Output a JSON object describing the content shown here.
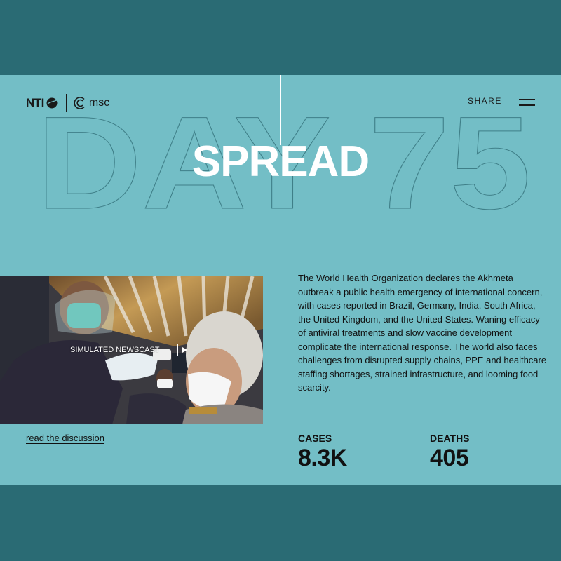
{
  "header": {
    "logo_nti": "NTI",
    "logo_msc": "msc",
    "share_label": "SHARE",
    "menu_icon": "hamburger-menu-icon"
  },
  "hero": {
    "background_text": "DAY 75",
    "title": "SPREAD"
  },
  "video": {
    "label": "SIMULATED NEWSCAST",
    "play_icon": "play-icon",
    "link_label": "read the discussion"
  },
  "description": "The World Health Organization declares the Akhmeta outbreak a public health emergency of international concern, with cases reported in Brazil, Germany, India, South Africa, the United Kingdom, and the United States. Waning efficacy of antiviral treatments and slow vaccine development complicate the international response. The world also faces challenges from disrupted supply chains, PPE and healthcare staffing shortages, strained infrastructure, and looming food scarcity.",
  "stats": {
    "cases_label": "CASES",
    "cases_value": "8.3K",
    "deaths_label": "DEATHS",
    "deaths_value": "405"
  },
  "colors": {
    "dark_band": "#2a6b74",
    "panel": "#73bec6",
    "title": "#ffffff",
    "text": "#111111"
  }
}
